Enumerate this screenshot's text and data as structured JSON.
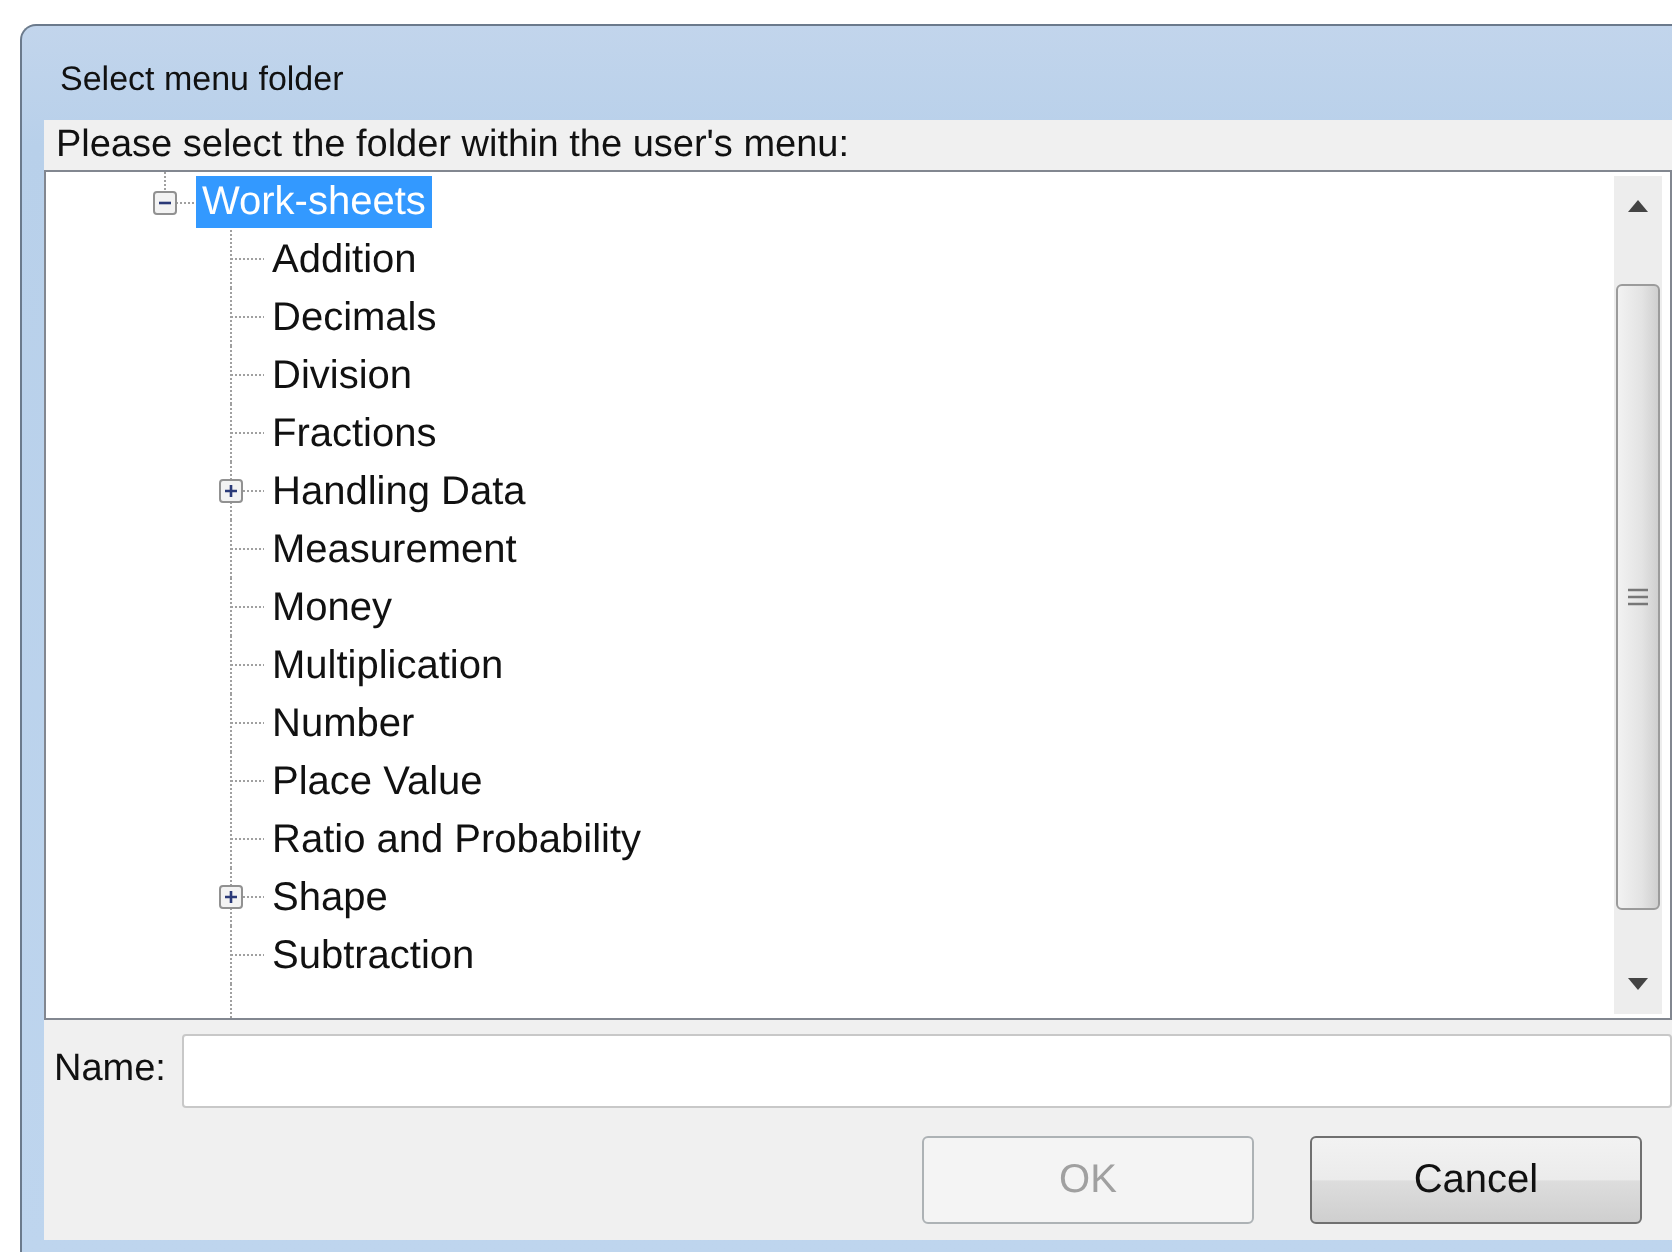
{
  "window": {
    "title": "Select menu folder"
  },
  "prompt": "Please select the folder within the user's menu:",
  "tree": [
    {
      "label": "Work-sheets",
      "selected": true,
      "expanded": true,
      "children": [
        {
          "label": "Addition",
          "selected": false,
          "kind": "leaf"
        },
        {
          "label": "Decimals",
          "selected": false,
          "kind": "leaf"
        },
        {
          "label": "Division",
          "selected": false,
          "kind": "leaf"
        },
        {
          "label": "Fractions",
          "selected": false,
          "kind": "leaf"
        },
        {
          "label": "Handling Data",
          "selected": false,
          "kind": "folder"
        },
        {
          "label": "Measurement",
          "selected": false,
          "kind": "leaf"
        },
        {
          "label": "Money",
          "selected": false,
          "kind": "leaf"
        },
        {
          "label": "Multiplication",
          "selected": false,
          "kind": "leaf"
        },
        {
          "label": "Number",
          "selected": false,
          "kind": "leaf"
        },
        {
          "label": "Place Value",
          "selected": false,
          "kind": "leaf"
        },
        {
          "label": "Ratio and Probability",
          "selected": false,
          "kind": "leaf"
        },
        {
          "label": "Shape",
          "selected": false,
          "kind": "folder"
        },
        {
          "label": "Subtraction",
          "selected": false,
          "kind": "leaf"
        }
      ]
    }
  ],
  "name_field": {
    "label": "Name:"
  },
  "buttons": [
    {
      "label": "OK",
      "disabled": true
    },
    {
      "label": "Cancel",
      "disabled": false
    }
  ]
}
